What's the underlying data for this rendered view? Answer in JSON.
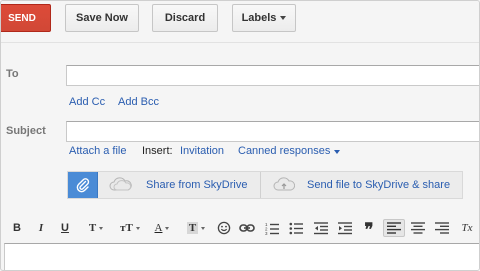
{
  "toolbar": {
    "send_label": "SEND",
    "save_label": "Save Now",
    "discard_label": "Discard",
    "labels_label": "Labels"
  },
  "to": {
    "label": "To",
    "value": ""
  },
  "recipients": {
    "add_cc": "Add Cc",
    "add_bcc": "Add Bcc"
  },
  "subject": {
    "label": "Subject",
    "value": ""
  },
  "attachments": {
    "attach_file": "Attach a file",
    "insert_label": "Insert:",
    "invitation": "Invitation",
    "canned_responses": "Canned responses"
  },
  "skydrive": {
    "share_from": "Share from SkyDrive",
    "send_to": "Send file to SkyDrive & share"
  },
  "format": {
    "bold": "B",
    "italic": "I",
    "underline": "U",
    "font": "T",
    "size": "тT",
    "text_color": "A",
    "highlight": "T",
    "quote": "❞",
    "clear": "Tx"
  },
  "body": {
    "value": ""
  },
  "colors": {
    "send": "#d14836",
    "link": "#2a5db0",
    "drive": "#4a8bd6"
  }
}
